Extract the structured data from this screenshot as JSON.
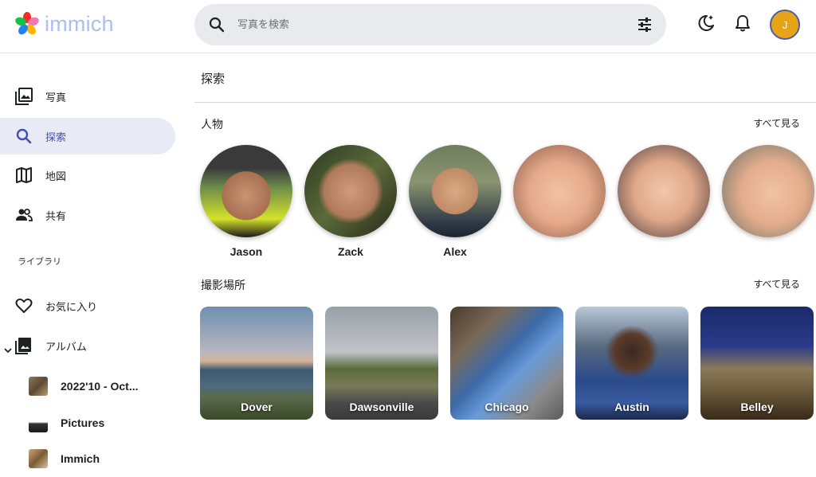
{
  "app": {
    "name": "immich"
  },
  "search": {
    "placeholder": "写真を検索"
  },
  "user": {
    "initial": "J"
  },
  "sidebar": {
    "items": [
      {
        "label": "写真",
        "icon": "photos-icon"
      },
      {
        "label": "探索",
        "icon": "search-icon",
        "active": true
      },
      {
        "label": "地図",
        "icon": "map-icon"
      },
      {
        "label": "共有",
        "icon": "people-icon"
      }
    ],
    "library_label": "ライブラリ",
    "library_items": [
      {
        "label": "お気に入り",
        "icon": "heart-icon"
      },
      {
        "label": "アルバム",
        "icon": "album-icon"
      }
    ],
    "albums": [
      {
        "label": "2022'10 - Oct..."
      },
      {
        "label": "Pictures"
      },
      {
        "label": "Immich"
      }
    ]
  },
  "main": {
    "title": "探索",
    "people": {
      "title": "人物",
      "see_all": "すべて見る",
      "items": [
        {
          "name": "Jason"
        },
        {
          "name": "Zack"
        },
        {
          "name": "Alex"
        },
        {
          "name": ""
        },
        {
          "name": ""
        },
        {
          "name": ""
        }
      ]
    },
    "places": {
      "title": "撮影場所",
      "see_all": "すべて見る",
      "items": [
        {
          "name": "Dover"
        },
        {
          "name": "Dawsonville"
        },
        {
          "name": "Chicago"
        },
        {
          "name": "Austin"
        },
        {
          "name": "Belley"
        }
      ]
    }
  },
  "colors": {
    "accent": "#4250af",
    "active_bg": "#e8eaf6",
    "avatar": "#e7a417",
    "logo_text": "#a9bff5",
    "search_bg": "#e8eaed"
  }
}
